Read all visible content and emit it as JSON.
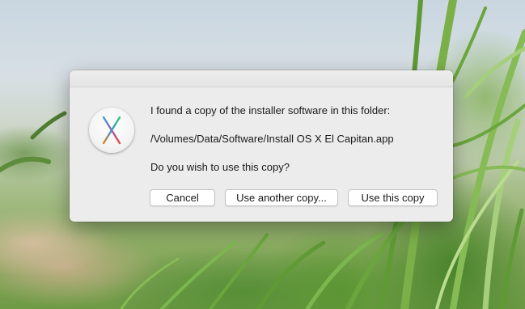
{
  "dialog": {
    "message_line_1": "I found a copy of the installer software in this folder:",
    "message_path": "/Volumes/Data/Software/Install OS X El Capitan.app",
    "message_question": "Do you wish to use this copy?",
    "icon": "os-x-el-capitan-x-icon",
    "buttons": {
      "cancel": "Cancel",
      "use_another": "Use another copy...",
      "use_this": "Use this copy"
    }
  }
}
